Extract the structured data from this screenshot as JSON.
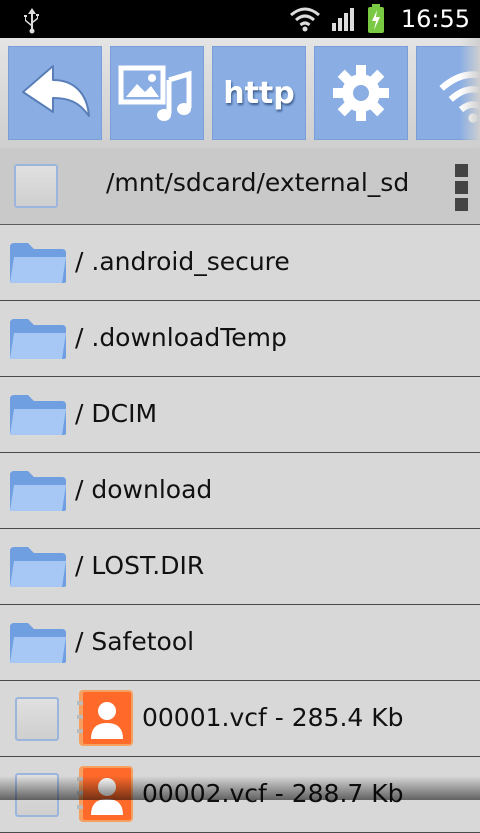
{
  "status_bar": {
    "time": "16:55"
  },
  "path": "/mnt/sdcard/external_sd",
  "folders": [
    {
      "label": "/ .android_secure"
    },
    {
      "label": "/ .downloadTemp"
    },
    {
      "label": "/ DCIM"
    },
    {
      "label": "/ download"
    },
    {
      "label": "/ LOST.DIR"
    },
    {
      "label": "/ Safetool"
    }
  ],
  "files": [
    {
      "label": "00001.vcf - 285.4 Kb"
    },
    {
      "label": "00002.vcf - 288.7 Kb"
    }
  ],
  "colors": {
    "toolbar_button": "#8aaee4",
    "status_bar": "#000000",
    "battery": "#7ac943",
    "contact_icon": "#ff6a2b"
  },
  "icons": {
    "back": "back-arrow-icon",
    "media": "media-icon",
    "settings": "gear-icon",
    "wifi": "wifi-icon",
    "folder": "folder-icon",
    "contact": "contact-card-icon"
  }
}
